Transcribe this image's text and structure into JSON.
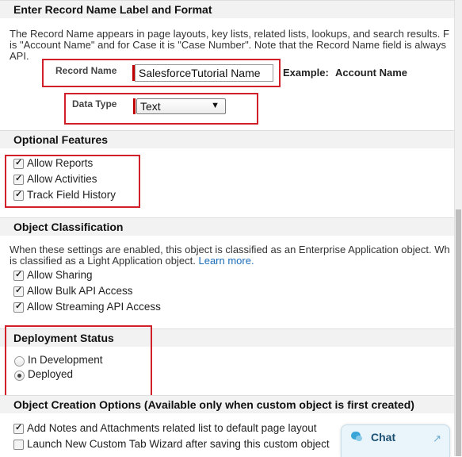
{
  "sections": {
    "record_name": "Enter Record Name Label and Format",
    "optional_features": "Optional Features",
    "object_classification": "Object Classification",
    "deployment_status": "Deployment Status",
    "creation_options": "Object Creation Options (Available only when custom object is first created)"
  },
  "record_name": {
    "desc_line1": "The Record Name appears in page layouts, key lists, related lists, lookups, and search results. F",
    "desc_line2": "is \"Account Name\" and for Case it is \"Case Number\". Note that the Record Name field is always",
    "desc_line3": "API.",
    "label": "Record Name",
    "value": "SalesforceTutorial Name",
    "example_label": "Example:",
    "example_value": "Account Name",
    "data_type_label": "Data Type",
    "data_type_value": "Text"
  },
  "optional_features": [
    {
      "label": "Allow Reports",
      "checked": true
    },
    {
      "label": "Allow Activities",
      "checked": true
    },
    {
      "label": "Track Field History",
      "checked": true
    }
  ],
  "object_classification": {
    "desc_line1": "When these settings are enabled, this object is classified as an Enterprise Application object. Wh",
    "desc_line2": "is classified as a Light Application object.",
    "learn_more": "Learn more.",
    "options": [
      {
        "label": "Allow Sharing",
        "checked": true
      },
      {
        "label": "Allow Bulk API Access",
        "checked": true
      },
      {
        "label": "Allow Streaming API Access",
        "checked": true
      }
    ]
  },
  "deployment_status": {
    "options": [
      {
        "label": "In Development",
        "selected": false
      },
      {
        "label": "Deployed",
        "selected": true
      }
    ]
  },
  "creation_options": [
    {
      "label": "Add Notes and Attachments related list to default page layout",
      "checked": true
    },
    {
      "label": "Launch New Custom Tab Wizard after saving this custom object",
      "checked": false
    }
  ],
  "chat": {
    "label": "Chat",
    "icon": "chat-bubble-icon",
    "expand_icon": "expand-arrow-icon"
  },
  "colors": {
    "highlight": "#d0202a",
    "required": "#c00000",
    "link": "#1a6cb8",
    "chat_bg": "#eaf5fb"
  }
}
